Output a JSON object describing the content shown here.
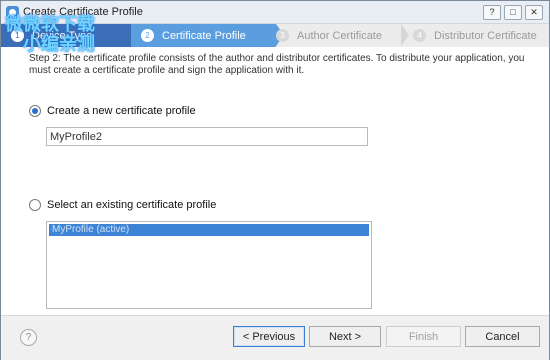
{
  "window": {
    "title": "Create Certificate Profile"
  },
  "steps": [
    {
      "number": "1",
      "label": "Device Type"
    },
    {
      "number": "2",
      "label": "Certificate Profile"
    },
    {
      "number": "3",
      "label": "Author Certificate"
    },
    {
      "number": "4",
      "label": "Distributor Certificate"
    }
  ],
  "description": "Step 2: The certificate profile consists of the author and distributor certificates. To distribute your application, you must create a certificate profile and sign the application with it.",
  "options": {
    "create_new_label": "Create a new certificate profile",
    "profile_name_value": "MyProfile2",
    "select_existing_label": "Select an existing certificate profile",
    "existing_profiles": [
      "MyProfile (active)"
    ]
  },
  "watermark": {
    "line1": "微微软下载",
    "line2": "小编亲测"
  },
  "buttons": {
    "help": "?",
    "previous": "< Previous",
    "next": "Next >",
    "finish": "Finish",
    "cancel": "Cancel"
  }
}
